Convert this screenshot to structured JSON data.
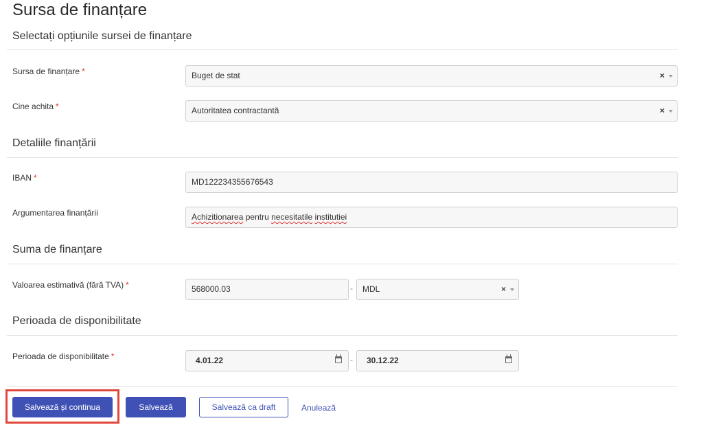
{
  "page": {
    "title": "Sursa de finanțare"
  },
  "sections": {
    "options": "Selectați opțiunile sursei de finanțare",
    "details": "Detaliile finanțării",
    "amount": "Suma de finanțare",
    "period": "Perioada de disponibilitate"
  },
  "fields": {
    "source": {
      "label": "Sursa de finanțare",
      "value": "Buget de stat"
    },
    "payer": {
      "label": "Cine achita",
      "value": "Autoritatea contractantă"
    },
    "iban": {
      "label": "IBAN",
      "value": "MD122234355676543"
    },
    "justification": {
      "label": "Argumentarea finanțării",
      "value_words": [
        "Achizitionarea",
        "pentru",
        "necesitatile",
        "institutiei"
      ]
    },
    "estimated_value": {
      "label": "Valoarea estimativă (fără TVA)",
      "amount": "568000.03",
      "currency": "MDL"
    },
    "availability": {
      "label": "Perioada de disponibilitate",
      "start": "4.01.22",
      "end": "30.12.22"
    }
  },
  "common": {
    "required_mark": "*",
    "clear_symbol": "×",
    "separator": "-"
  },
  "actions": {
    "save_continue": "Salvează și continua",
    "save": "Salvează",
    "save_draft": "Salvează ca draft",
    "cancel": "Anulează"
  },
  "colors": {
    "primary": "#3f51b5",
    "required": "#d9362b",
    "highlight": "#e2463a"
  }
}
